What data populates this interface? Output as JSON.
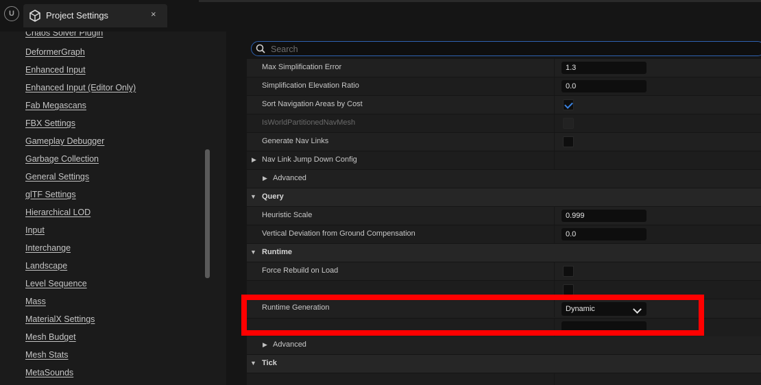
{
  "app": {
    "logo_text": "U"
  },
  "tab": {
    "title": "Project Settings",
    "close_label": "×",
    "icon": "settings-cube-icon"
  },
  "sidebar": {
    "partial_top_item": "Chaos Solver Plugin",
    "items": [
      "DeformerGraph",
      "Enhanced Input",
      "Enhanced Input (Editor Only)",
      "Fab Megascans",
      "FBX Settings",
      "Gameplay Debugger",
      "Garbage Collection",
      "General Settings",
      "glTF Settings",
      "Hierarchical LOD",
      "Input",
      "Interchange",
      "Landscape",
      "Level Sequence",
      "Mass",
      "MaterialX Settings",
      "Mesh Budget",
      "Mesh Stats",
      "MetaSounds"
    ]
  },
  "search": {
    "placeholder": "Search"
  },
  "rows": [
    {
      "label": "Max Simplification Error",
      "value": "1.3"
    },
    {
      "label": "Simplification Elevation Ratio",
      "value": "0.0"
    },
    {
      "label": "Sort Navigation Areas by Cost",
      "checked": true
    },
    {
      "label": "IsWorldPartitionedNavMesh",
      "checked": false,
      "disabled": true
    },
    {
      "label": "Generate Nav Links",
      "checked": false
    },
    {
      "label": "Nav Link Jump Down Config"
    },
    {
      "label": "Advanced"
    },
    {
      "label": "Query"
    },
    {
      "label": "Heuristic Scale",
      "value": "0.999"
    },
    {
      "label": "Vertical Deviation from Ground Compensation",
      "value": "0.0"
    },
    {
      "label": "Runtime"
    },
    {
      "label": "Force Rebuild on Load",
      "checked": false
    },
    {
      "label": "Runtime Generation",
      "value": "Dynamic"
    },
    {
      "label": "Advanced"
    },
    {
      "label": "Tick"
    }
  ],
  "colors": {
    "highlight": "#ff0000",
    "accent": "#2f63b2",
    "check": "#3a82e0"
  }
}
